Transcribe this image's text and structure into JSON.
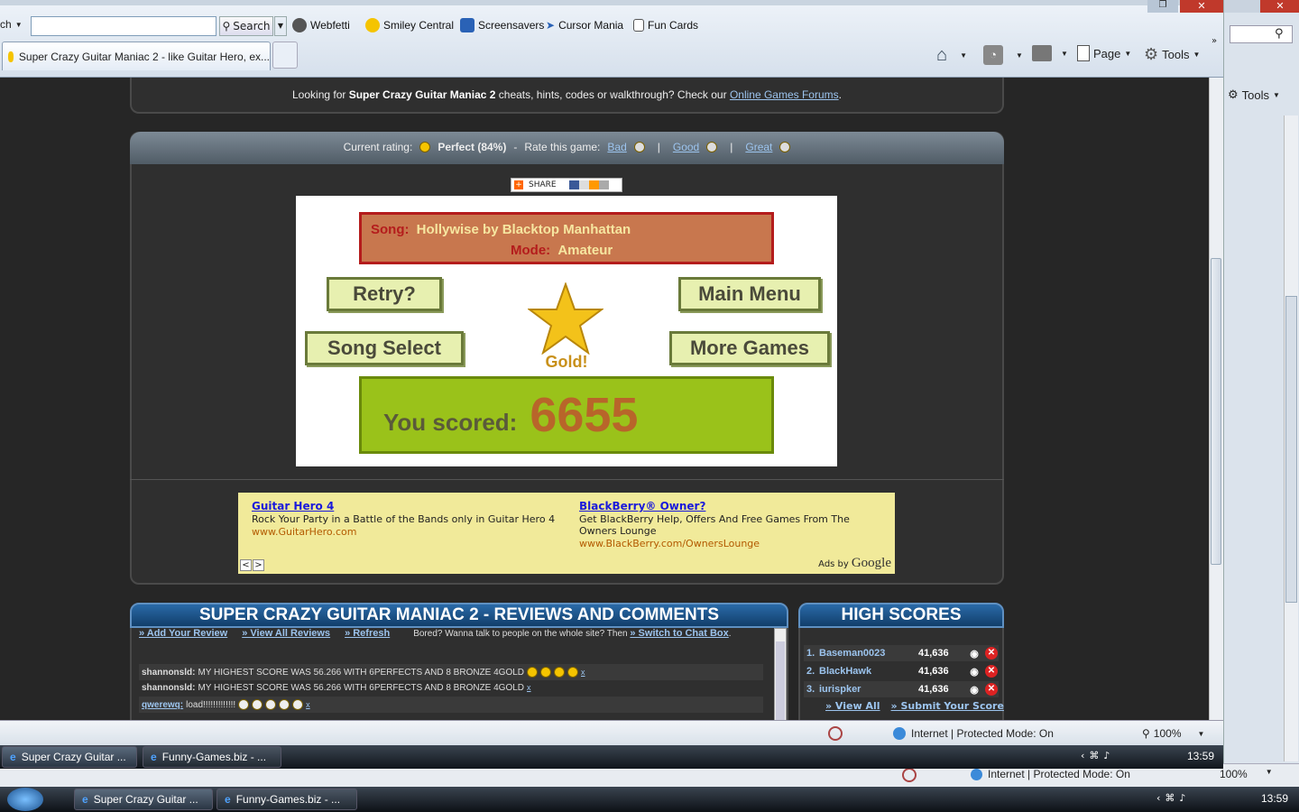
{
  "toolbar": {
    "search_dropdown_label": "ch",
    "search_placeholder": "",
    "search_button": "Search",
    "links": [
      "Webfetti",
      "Smiley Central",
      "Screensavers",
      "Cursor Mania",
      "Fun Cards"
    ]
  },
  "tab": {
    "title": "Super Crazy Guitar Maniac 2 - like Guitar Hero, ex..."
  },
  "commands": {
    "page": "Page",
    "tools": "Tools",
    "back_tools": "Tools"
  },
  "forum_banner": {
    "prefix": "Looking for ",
    "game": "Super Crazy Guitar Maniac 2",
    "middle": " cheats, hints, codes or walkthrough? Check our ",
    "link": "Online Games Forums",
    "suffix": "."
  },
  "rating": {
    "label": "Current rating:",
    "value": "Perfect (84%)",
    "sep": "-",
    "rate_label": "Rate this game:",
    "bad": "Bad",
    "good": "Good",
    "great": "Great",
    "pipe": "|"
  },
  "share": {
    "label": "SHARE"
  },
  "game": {
    "song_label": "Song:",
    "song_value": "Hollywise by Blacktop Manhattan",
    "mode_label": "Mode:",
    "mode_value": "Amateur",
    "retry": "Retry?",
    "main_menu": "Main Menu",
    "song_select": "Song Select",
    "more_games": "More Games",
    "medal": "Gold!",
    "score_label": "You scored:",
    "score_value": "6655"
  },
  "ads": {
    "items": [
      {
        "title": "Guitar Hero 4",
        "text": "Rock Your Party in a Battle of the Bands only in Guitar Hero 4",
        "url": "www.GuitarHero.com"
      },
      {
        "title": "BlackBerry® Owner?",
        "text": "Get BlackBerry Help, Offers And Free Games From The Owners Lounge",
        "url": "www.BlackBerry.com/OwnersLounge"
      }
    ],
    "ads_by": "Ads by",
    "google": "Google",
    "prev": "<",
    "next": ">"
  },
  "reviews": {
    "title": "SUPER CRAZY GUITAR MANIAC 2 - REVIEWS AND COMMENTS",
    "add": "» Add Your Review",
    "view_all": "» View All Reviews",
    "refresh": "» Refresh",
    "bored": "Bored? Wanna talk to people on the whole site? Then",
    "chat": "» Switch to Chat Box",
    "chat_suffix": ".",
    "comments": [
      {
        "user": "shannonsld:",
        "text": "MY HIGHEST SCORE WAS 56.266 WITH 6PERFECTS AND 8 BRONZE 4GOLD",
        "x": "x"
      },
      {
        "user": "shannonsld:",
        "text": "MY HIGHEST SCORE WAS 56.266 WITH 6PERFECTS AND 8 BRONZE 4GOLD",
        "x": "x"
      },
      {
        "user": "qwerewq:",
        "text": "load!!!!!!!!!!!!!",
        "x": "x"
      }
    ]
  },
  "highscores": {
    "title": "HIGH SCORES",
    "rows": [
      {
        "rank": "1.",
        "name": "Baseman0023",
        "score": "41,636"
      },
      {
        "rank": "2.",
        "name": "BlackHawk",
        "score": "41,636"
      },
      {
        "rank": "3.",
        "name": "iurispker",
        "score": "41,636"
      }
    ],
    "view_all": "» View All",
    "submit": "» Submit Your Score"
  },
  "status": {
    "zone": "Internet | Protected Mode: On",
    "zoom": "100%"
  },
  "taskbar": {
    "tasks": [
      "Super Crazy Guitar ...",
      "Funny-Games.biz - ..."
    ],
    "clock": "13:59"
  },
  "back_status": {
    "zone": "Internet | Protected Mode: On",
    "zoom": "100%"
  }
}
